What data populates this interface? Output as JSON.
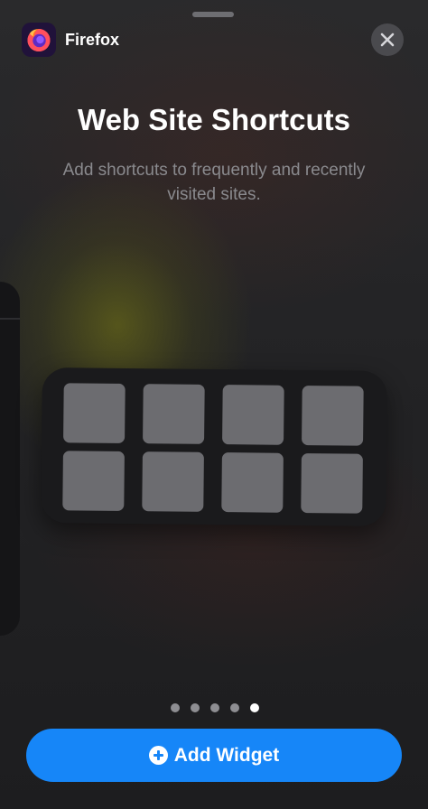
{
  "header": {
    "app_name": "Firefox",
    "app_icon": "firefox-logo",
    "close_icon": "close-x-icon"
  },
  "widget_info": {
    "title": "Web Site Shortcuts",
    "description": "Add shortcuts to frequently and recently visited sites."
  },
  "preview": {
    "tile_count": 8
  },
  "pagination": {
    "total_pages": 5,
    "current_page": 5
  },
  "footer": {
    "add_label": "Add Widget",
    "add_icon": "plus-circle-icon"
  },
  "colors": {
    "accent": "#1686f8",
    "tile": "#6c6c70",
    "widget_background": "#1a1a1c"
  }
}
